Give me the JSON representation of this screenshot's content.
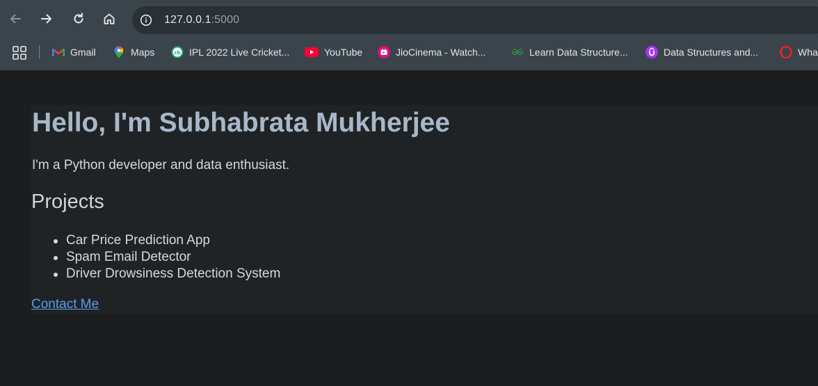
{
  "browser": {
    "url_host": "127.0.0.1",
    "url_port": ":5000",
    "bookmarks": [
      {
        "label": "Gmail",
        "icon": "gmail-icon"
      },
      {
        "label": "Maps",
        "icon": "maps-icon"
      },
      {
        "label": "IPL 2022 Live Cricket...",
        "icon": "cricbuzz-icon"
      },
      {
        "label": "YouTube",
        "icon": "youtube-icon"
      },
      {
        "label": "JioCinema - Watch...",
        "icon": "jiocinema-icon"
      },
      {
        "label": "Learn Data Structure...",
        "icon": "geeksforgeeks-icon"
      },
      {
        "label": "Data Structures and...",
        "icon": "udemy-icon"
      },
      {
        "label": "Wha",
        "icon": "opera-icon"
      }
    ]
  },
  "page": {
    "title": "Hello, I'm Subhabrata Mukherjee",
    "intro": "I'm a Python developer and data enthusiast.",
    "projects_heading": "Projects",
    "projects": [
      "Car Price Prediction App",
      "Spam Email Detector",
      "Driver Drowsiness Detection System"
    ],
    "contact_label": "Contact Me"
  },
  "colors": {
    "chrome_bg": "#3b444b",
    "page_bg": "#1b1d1f",
    "content_bg": "#202325",
    "title": "#a9b8c8",
    "link": "#5a9cf0"
  }
}
